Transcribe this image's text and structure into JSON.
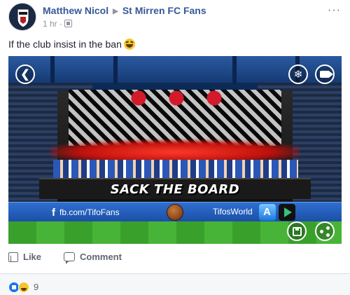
{
  "post": {
    "author": "Matthew Nicol",
    "group": "St Mirren FC Fans",
    "timestamp": "1 hr",
    "separator": "·",
    "arrow": "▶",
    "text": "If the club insist in the ban",
    "more": "···"
  },
  "media": {
    "banner_text": "SACK THE BOARD",
    "ad_left": "fb.com/TifoFans",
    "ad_right": "TifosWorld",
    "fb_glyph": "f",
    "back_glyph": "❮",
    "snow_glyph": "❄"
  },
  "actions": {
    "like_label": "Like",
    "comment_label": "Comment"
  },
  "reactions": {
    "count": "9",
    "types": [
      "like",
      "haha"
    ]
  },
  "colors": {
    "link": "#365899",
    "meta": "#90949c",
    "like_blue": "#1877f2"
  },
  "icons": [
    "back-icon",
    "snowflake-icon",
    "video-icon",
    "save-icon",
    "share-icon",
    "globe-icon",
    "like-icon",
    "comment-icon"
  ]
}
